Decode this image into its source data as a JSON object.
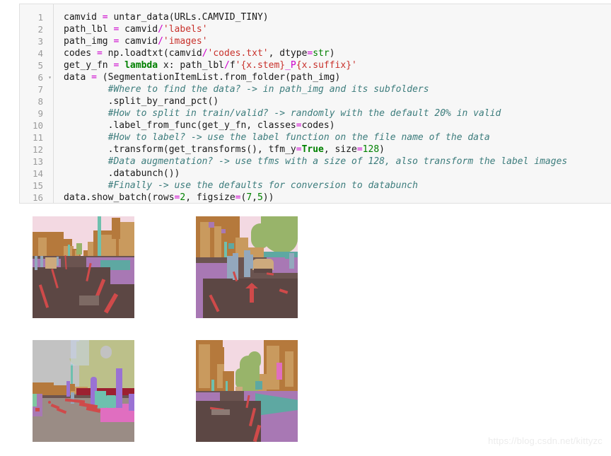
{
  "notebook": {
    "cell_type": "code",
    "fold_marker_line": 6,
    "line_numbers": [
      "1",
      "2",
      "3",
      "4",
      "5",
      "6",
      "7",
      "8",
      "9",
      "10",
      "11",
      "12",
      "13",
      "14",
      "15",
      "16"
    ],
    "fold_arrow_glyph": "▾",
    "code_lines": [
      "camvid = untar_data(URLs.CAMVID_TINY)",
      "path_lbl = camvid/'labels'",
      "path_img = camvid/'images'",
      "codes = np.loadtxt(camvid/'codes.txt', dtype=str)",
      "get_y_fn = lambda x: path_lbl/f'{x.stem}_P{x.suffix}'",
      "data = (SegmentationItemList.from_folder(path_img)",
      "        #Where to find the data? -> in path_img and its subfolders",
      "        .split_by_rand_pct()",
      "        #How to split in train/valid? -> randomly with the default 20% in valid",
      "        .label_from_func(get_y_fn, classes=codes)",
      "        #How to label? -> use the label function on the file name of the data",
      "        .transform(get_transforms(), tfm_y=True, size=128)",
      "        #Data augmentation? -> use tfms with a size of 128, also transform the label images",
      "        .databunch())",
      "        #Finally -> use the defaults for conversion to databunch",
      "data.show_batch(rows=2, figsize=(7,5))"
    ]
  },
  "output": {
    "kind": "image-grid",
    "rows": 2,
    "cols": 2,
    "figsize": "(7,5)",
    "images": [
      {
        "id": "camvid-sample-1",
        "caption": "Segmented street scene with terraced buildings, pink sky and purple sidewalk"
      },
      {
        "id": "camvid-sample-2",
        "caption": "Segmented street scene with pedestrians, parked car and red road arrow"
      },
      {
        "id": "camvid-sample-3",
        "caption": "Segmented scene with grey sky, bare olive trees, purple poles and pink pavement"
      },
      {
        "id": "camvid-sample-4",
        "caption": "Segmented street scene with green tree, teal fence and purple sidewalk"
      }
    ]
  },
  "watermark": {
    "text": "https://blog.csdn.net/kittyzc"
  },
  "theme": {
    "cell_background": "#f7f7f7",
    "cell_border": "#e0e0e0",
    "gutter_text": "#9a9a9a",
    "code_text": "#1a1a1a",
    "operator": "#cc00cc",
    "string": "#c8312b",
    "keyword": "#008000",
    "number": "#008000",
    "comment": "#3c7c7c",
    "page_background": "#ffffff"
  }
}
